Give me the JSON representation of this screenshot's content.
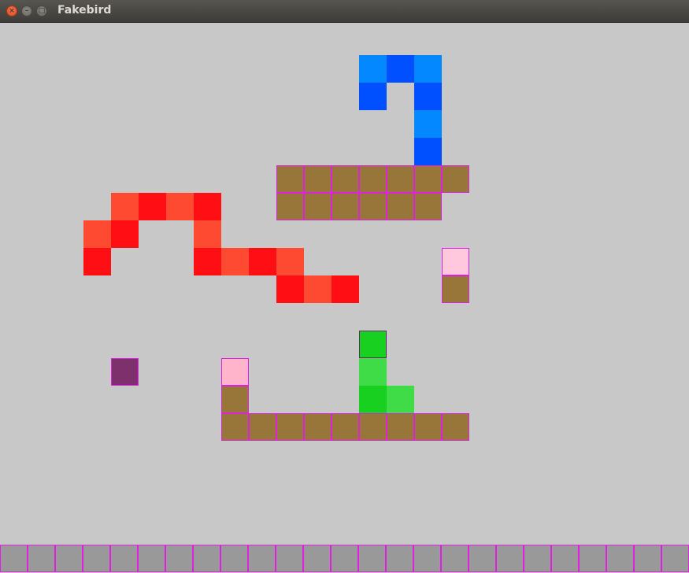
{
  "window": {
    "title": "Fakebird"
  },
  "icons": {
    "close": "close-icon",
    "minimize": "minimize-icon",
    "maximize": "maximize-icon"
  },
  "colors": {
    "background": "#c8c8c8",
    "dirt": "#98763a",
    "tile_border": "#e020e0",
    "ground": "#999999",
    "fruit": "#ffc8dc",
    "fruit_alt": "#ffb4cc",
    "exit": "#7e306c",
    "blue_light": "#0488ff",
    "blue_dark": "#0050ff",
    "red_light": "#ff4a32",
    "red_dark": "#ff0f14",
    "green_dark": "#18d020",
    "green_light": "#40dc48"
  }
}
